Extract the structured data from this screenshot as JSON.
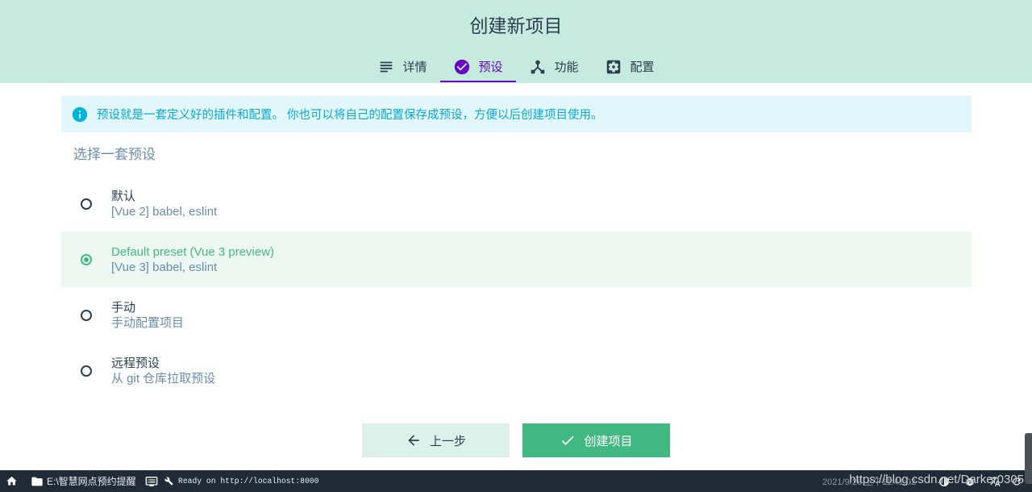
{
  "header": {
    "title": "创建新项目",
    "tabs": [
      {
        "label": "详情",
        "icon": "subject-icon",
        "active": false
      },
      {
        "label": "预设",
        "icon": "check-circle-icon",
        "active": true
      },
      {
        "label": "功能",
        "icon": "device-hub-icon",
        "active": false
      },
      {
        "label": "配置",
        "icon": "settings-applications-icon",
        "active": false
      }
    ]
  },
  "info_banner": {
    "icon": "info-icon",
    "text": "预设就是一套定义好的插件和配置。 你也可以将自己的配置保存成预设，方便以后创建项目使用。"
  },
  "section_title": "选择一套预设",
  "presets": [
    {
      "title": "默认",
      "description": "[Vue 2] babel, eslint",
      "selected": false
    },
    {
      "title": "Default preset (Vue 3 preview)",
      "description": "[Vue 3] babel, eslint",
      "selected": true
    },
    {
      "title": "手动",
      "description": "手动配置项目",
      "selected": false
    },
    {
      "title": "远程预设",
      "description": "从 git 仓库拉取预设",
      "selected": false
    }
  ],
  "actions": {
    "back_label": "上一步",
    "back_icon": "arrow-back-icon",
    "create_label": "创建项目",
    "create_icon": "check-icon"
  },
  "status_bar": {
    "folder_path": "E:\\智慧网点预约提醒",
    "log_text": "Ready on http://localhost:8000",
    "datetime": "2021/9/28 上午11:41:02",
    "icons": [
      "home-icon",
      "folder-icon",
      "console-icon",
      "wrench-icon",
      "contrast-icon",
      "bug-report-icon",
      "translate-icon",
      "refresh-icon"
    ]
  },
  "watermark": "https://blog.csdn.net/Darker0305",
  "colors": {
    "primary": "#42b983",
    "accent": "#6806c1",
    "header_bg": "#c6eadd",
    "text": "#2c3e50",
    "neutral_text": "#6a8bad",
    "info": "#03b3dc",
    "info_text": "#0aa8d4",
    "info_bg": "#e1f7fc",
    "selected_bg": "#eef8f3",
    "secondary_button_bg": "#ddf0ea",
    "status_bar_bg": "#1f2b37"
  }
}
